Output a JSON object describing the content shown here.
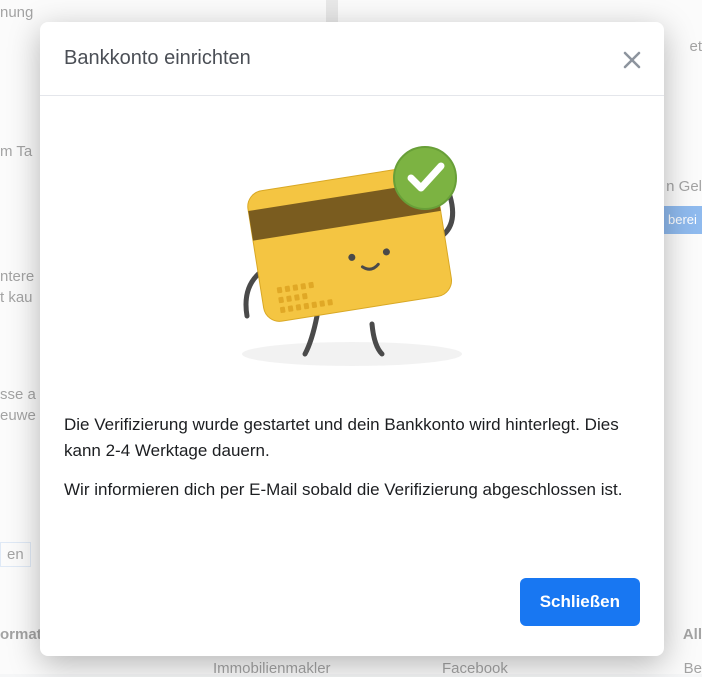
{
  "modal": {
    "title": "Bankkonto einrichten",
    "para1": "Die Verifizierung wurde gestartet und dein Bankkonto wird hinterlegt. Dies kann 2-4 Werktage dauern.",
    "para2": "Wir informieren dich per E-Mail sobald die Verifizierung abgeschlossen ist.",
    "close_button": "Schließen"
  },
  "background": {
    "left_fragments": [
      "nung",
      "m Ta",
      "ntere",
      "t kau",
      "sse a",
      "euwe",
      "en"
    ],
    "right_fragments": [
      "et",
      "n Gel",
      "berei",
      "All",
      "Be"
    ],
    "bottom": {
      "orma": "ormat",
      "immobilien": "Immobilienmakler",
      "facebook": "Facebook"
    }
  }
}
